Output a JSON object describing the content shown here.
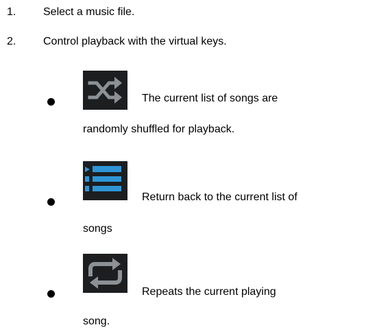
{
  "steps": [
    {
      "number": "1.",
      "text": "Select a music file."
    },
    {
      "number": "2.",
      "text": "Control playback with the virtual keys."
    }
  ],
  "features": [
    {
      "icon": "shuffle-icon",
      "line1": "The current list of songs are",
      "line2": "randomly shuffled for playback."
    },
    {
      "icon": "list-icon",
      "line1": "Return back to the current list of",
      "line2": "songs"
    },
    {
      "icon": "repeat-icon",
      "line1": "Repeats the current playing",
      "line2": "song."
    }
  ],
  "colors": {
    "icon_background": "#1c1e20",
    "shuffle_icon": "#8c9196",
    "list_icon": "#2f95d6",
    "repeat_icon": "#8c9196"
  }
}
